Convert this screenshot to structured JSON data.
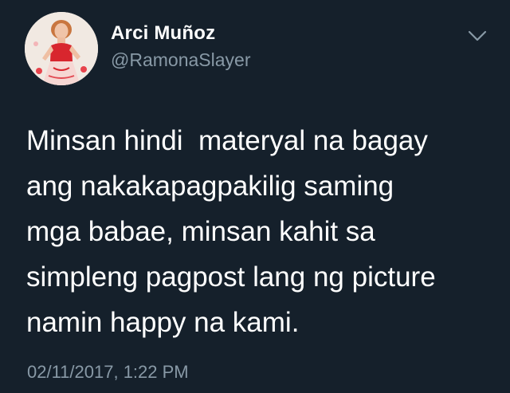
{
  "tweet": {
    "author_name": "Arci Muñoz",
    "author_handle": "@RamonaSlayer",
    "text": "Minsan hindi  materyal na bagay\nang nakakapagpakilig saming\nmga babae, minsan kahit sa\nsimpleng pagpost lang ng picture\nnamin happy na kami.",
    "timestamp": "02/11/2017, 1:22 PM"
  },
  "icons": {
    "menu": "chevron-down-icon",
    "avatar": "profile-photo"
  },
  "colors": {
    "background": "#15202b",
    "primary_text": "#ffffff",
    "secondary_text": "#8899a6"
  }
}
